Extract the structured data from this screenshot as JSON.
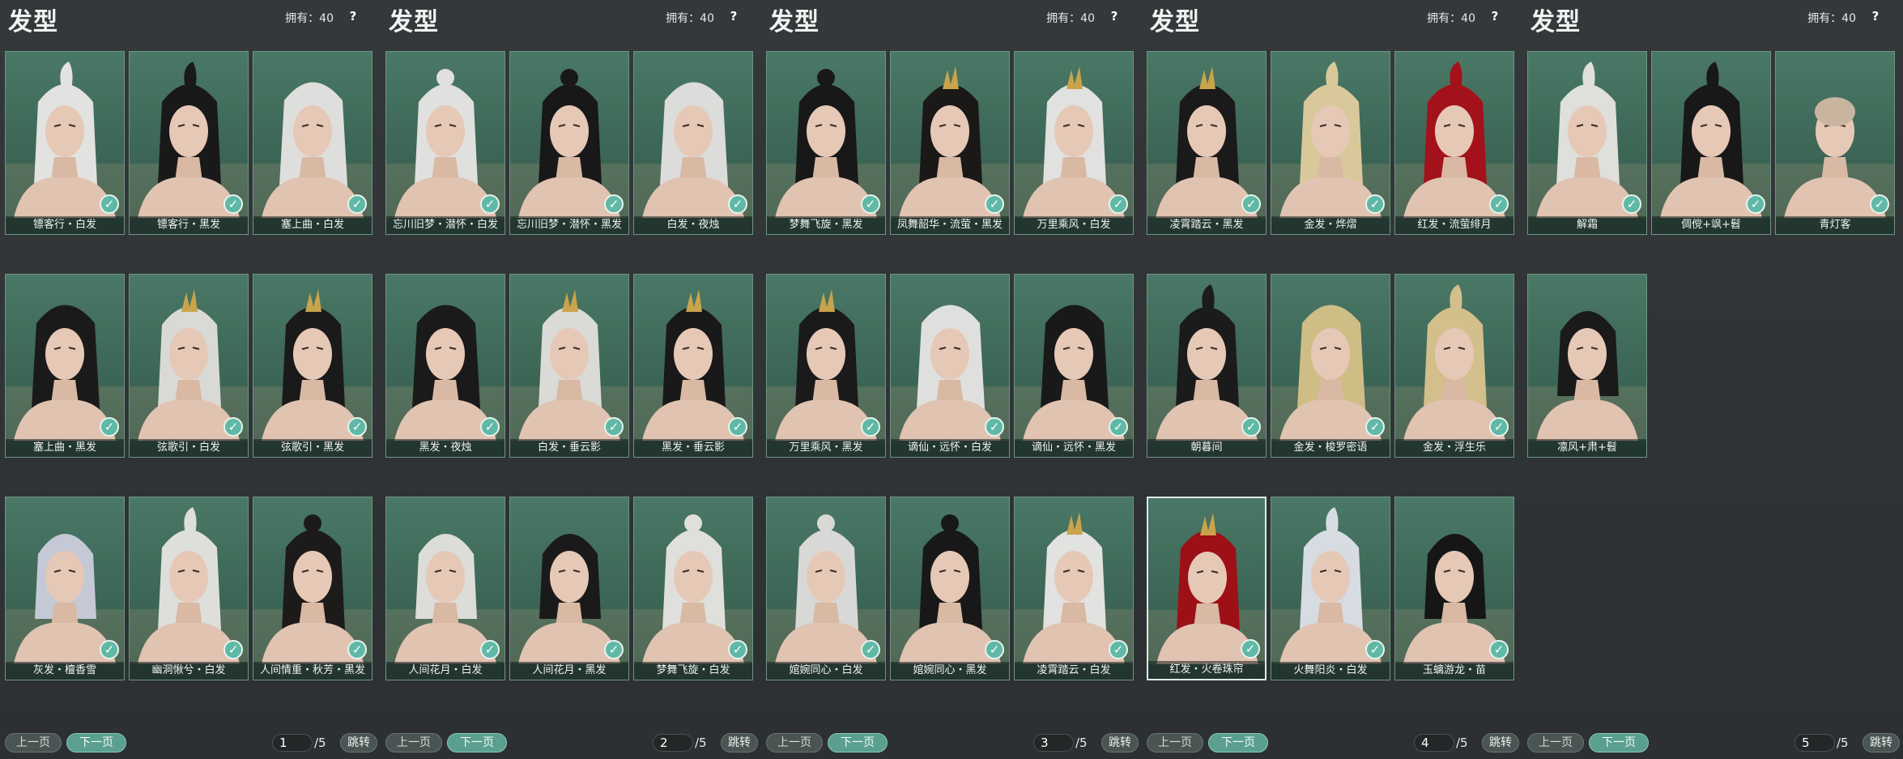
{
  "panel_title": "发型",
  "owned_text": "拥有：40",
  "help": "?",
  "check_glyph": "✓",
  "pager": {
    "prev_label": "上一页",
    "next_label": "下一页",
    "total": "/5",
    "jump_label": "跳转"
  },
  "icons": {
    "help": "help-icon",
    "check": "equipped-check-icon"
  },
  "colors": {
    "card_bg": "#3c6656",
    "badge": "#5fb9a6",
    "next_button": "#5a9f8f",
    "panel_bg": "#2f3335"
  },
  "panels": [
    {
      "page": "1",
      "items": [
        {
          "label": "镖客行・白发",
          "hair": "#e2e2e0",
          "style": "ponytail",
          "checked": true
        },
        {
          "label": "镖客行・黑发",
          "hair": "#19191a",
          "style": "ponytail",
          "checked": true
        },
        {
          "label": "塞上曲・白发",
          "hair": "#dedfdc",
          "style": "long",
          "checked": true
        },
        {
          "label": "塞上曲・黑发",
          "hair": "#1b1a1a",
          "style": "long",
          "checked": true
        },
        {
          "label": "弦歌引・白发",
          "hair": "#d9d9d5",
          "style": "crown",
          "checked": true
        },
        {
          "label": "弦歌引・黑发",
          "hair": "#1a1a1a",
          "style": "crown",
          "checked": true
        },
        {
          "label": "灰发・檀香雪",
          "hair": "#c5c9d6",
          "style": "short",
          "checked": true
        },
        {
          "label": "幽洞愀兮・白发",
          "hair": "#dededb",
          "style": "ponytail",
          "checked": true
        },
        {
          "label": "人间情重・秋芳・黑发",
          "hair": "#1c1b1a",
          "style": "bun",
          "checked": true
        }
      ]
    },
    {
      "page": "2",
      "items": [
        {
          "label": "忘川旧梦・潜怀・白发",
          "hair": "#e0e0de",
          "style": "bun",
          "checked": true
        },
        {
          "label": "忘川旧梦・潜怀・黑发",
          "hair": "#181818",
          "style": "bun",
          "checked": true
        },
        {
          "label": "白发・夜烛",
          "hair": "#dcdcda",
          "style": "long",
          "checked": true
        },
        {
          "label": "黑发・夜烛",
          "hair": "#1a1a1b",
          "style": "long",
          "checked": true
        },
        {
          "label": "白发・垂云影",
          "hair": "#dadad6",
          "style": "crown",
          "checked": true
        },
        {
          "label": "黑发・垂云影",
          "hair": "#191919",
          "style": "crown",
          "checked": true
        },
        {
          "label": "人间花月・白发",
          "hair": "#dcdcd9",
          "style": "short",
          "checked": true
        },
        {
          "label": "人间花月・黑发",
          "hair": "#1b1a1a",
          "style": "short",
          "checked": true
        },
        {
          "label": "梦舞飞旋・白发",
          "hair": "#dfdfdc",
          "style": "bun",
          "checked": true
        }
      ]
    },
    {
      "page": "3",
      "items": [
        {
          "label": "梦舞飞旋・黑发",
          "hair": "#181818",
          "style": "bun",
          "checked": true
        },
        {
          "label": "凤舞韶华・流萤・黑发",
          "hair": "#1a1918",
          "style": "crown",
          "checked": true
        },
        {
          "label": "万里乘风・白发",
          "hair": "#e1e1df",
          "style": "crown",
          "checked": true
        },
        {
          "label": "万里乘风・黑发",
          "hair": "#1a1a1a",
          "style": "crown",
          "checked": true
        },
        {
          "label": "谪仙・远怀・白发",
          "hair": "#dfe0de",
          "style": "long",
          "checked": true
        },
        {
          "label": "谪仙・远怀・黑发",
          "hair": "#191919",
          "style": "long",
          "checked": true
        },
        {
          "label": "婠婉同心・白发",
          "hair": "#d8d9d6",
          "style": "bun",
          "checked": true
        },
        {
          "label": "婠婉同心・黑发",
          "hair": "#181818",
          "style": "bun",
          "checked": true
        },
        {
          "label": "凌霄踏云・白发",
          "hair": "#e2e2e0",
          "style": "crown",
          "checked": true
        }
      ]
    },
    {
      "page": "4",
      "items": [
        {
          "label": "凌霄踏云・黑发",
          "hair": "#1a1a1a",
          "style": "crown",
          "checked": true
        },
        {
          "label": "金发・烨熠",
          "hair": "#d9c99a",
          "style": "ponytail",
          "checked": true
        },
        {
          "label": "红发・流萤绯月",
          "hair": "#a3121a",
          "style": "ponytail",
          "checked": true
        },
        {
          "label": "朝暮间",
          "hair": "#1b1b1b",
          "style": "ponytail",
          "checked": true
        },
        {
          "label": "金发・梭罗密语",
          "hair": "#cfbd86",
          "style": "long",
          "checked": true
        },
        {
          "label": "金发・浮生乐",
          "hair": "#d2bf8b",
          "style": "ponytail",
          "checked": true
        },
        {
          "label": "红发・火卷珠帘",
          "hair": "#9c1016",
          "style": "crown",
          "checked": true
        },
        {
          "label": "火舞阳炎・白发",
          "hair": "#d7dbe2",
          "style": "ponytail",
          "checked": true
        },
        {
          "label": "玉螭游龙・苗",
          "hair": "#161616",
          "style": "short",
          "checked": true
        }
      ]
    },
    {
      "page": "5",
      "items": [
        {
          "label": "解霜",
          "hair": "#dfdfdc",
          "style": "ponytail",
          "checked": true
        },
        {
          "label": "倜傥+飒+髫",
          "hair": "#181818",
          "style": "ponytail",
          "checked": true
        },
        {
          "label": "青灯客",
          "hair": "#c9b59f",
          "style": "bald",
          "checked": true
        },
        {
          "label": "凛风+肃+髫",
          "hair": "#1a1a1a",
          "style": "short",
          "checked": false
        }
      ]
    }
  ]
}
